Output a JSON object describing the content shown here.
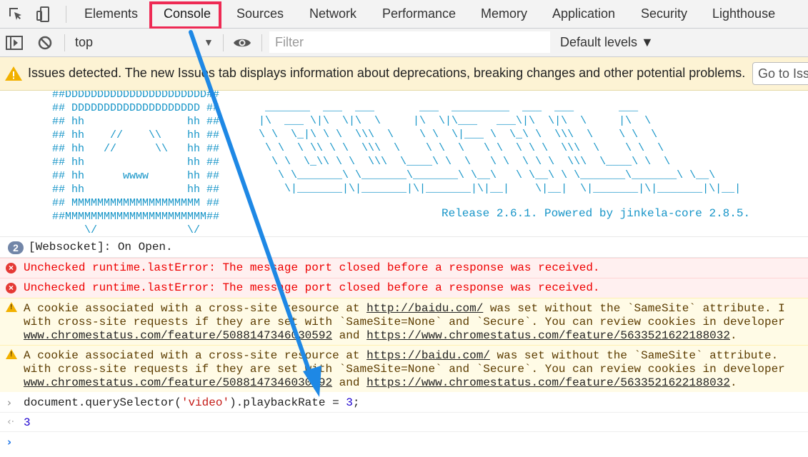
{
  "tabs": [
    "Elements",
    "Console",
    "Sources",
    "Network",
    "Performance",
    "Memory",
    "Application",
    "Security",
    "Lighthouse"
  ],
  "active_tab": "Console",
  "toolbar": {
    "context": "top",
    "filter_placeholder": "Filter",
    "levels": "Default levels ▼"
  },
  "issues": {
    "text": "Issues detected. The new Issues tab displays information about deprecations, breaking changes and other potential problems.",
    "button": "Go to Issues"
  },
  "banner": {
    "ascii_left": "##DDDDDDDDDDDDDDDDDDDDDD##\n## DDDDDDDDDDDDDDDDDDDD ##\n## hh                hh ##\n## hh    //    \\\\    hh ##\n## hh   //      \\\\   hh ##\n## hh                hh ##\n## hh      wwww      hh ##\n## hh                hh ##\n## MMMMMMMMMMMMMMMMMMMM ##\n##MMMMMMMMMMMMMMMMMMMMMM##\n     \\/              \\/",
    "ascii_right": " _______  ___  ___       ___  _________  ___  ___       ___\n|\\  ___ \\|\\  \\|\\  \\     |\\  \\|\\___   ___\\|\\  \\|\\  \\     |\\  \\\n\\ \\  \\_|\\ \\ \\  \\\\\\  \\    \\ \\  \\|___ \\  \\_\\ \\  \\\\\\  \\    \\ \\  \\\n \\ \\  \\ \\\\ \\ \\  \\\\\\  \\    \\ \\  \\   \\ \\  \\ \\ \\  \\\\\\  \\    \\ \\  \\\n  \\ \\  \\_\\\\ \\ \\  \\\\\\  \\____\\ \\  \\   \\ \\  \\ \\ \\  \\\\\\  \\____\\ \\  \\\n   \\ \\_______\\ \\_______\\_______\\ \\__\\   \\ \\__\\ \\ \\_______\\_______\\ \\__\\\n    \\|_______|\\|_______|\\|_______|\\|__|    \\|__|  \\|_______|\\|_______|\\|__|",
    "release": "Release 2.6.1. Powered by jinkela-core 2.8.5."
  },
  "messages": {
    "info_count": "2",
    "info_text": "[Websocket]: On Open.",
    "error_text": "Unchecked runtime.lastError: The message port closed before a response was received.",
    "warn1": {
      "pre": "A cookie associated with a cross-site resource at ",
      "link": "http://baidu.com/",
      "post": " was set without the `SameSite` attribute. I",
      "line2": "with cross-site requests if they are set with `SameSite=None` and `Secure`. You can review cookies in developer",
      "link2": "www.chromestatus.com/feature/5088147346030592",
      "and": " and ",
      "link3": "https://www.chromestatus.com/feature/5633521622188032",
      "end": "."
    },
    "warn2": {
      "pre": "A cookie associated with a cross-site resource at ",
      "link": "https://baidu.com/",
      "post": " was set without the `SameSite` attribute.",
      "line2": "with cross-site requests if they are set with `SameSite=None` and `Secure`. You can review cookies in developer",
      "link2": "www.chromestatus.com/feature/5088147346030592",
      "and": " and ",
      "link3": "https://www.chromestatus.com/feature/5633521622188032",
      "end": "."
    },
    "input": {
      "pre": "document.querySelector(",
      "str": "'video'",
      "mid": ").playbackRate = ",
      "num": "3",
      "end": ";"
    },
    "result": "3"
  },
  "colors": {
    "highlight_box": "#ee2a54",
    "arrow": "#1e88e5",
    "ascii": "#1795c8"
  }
}
